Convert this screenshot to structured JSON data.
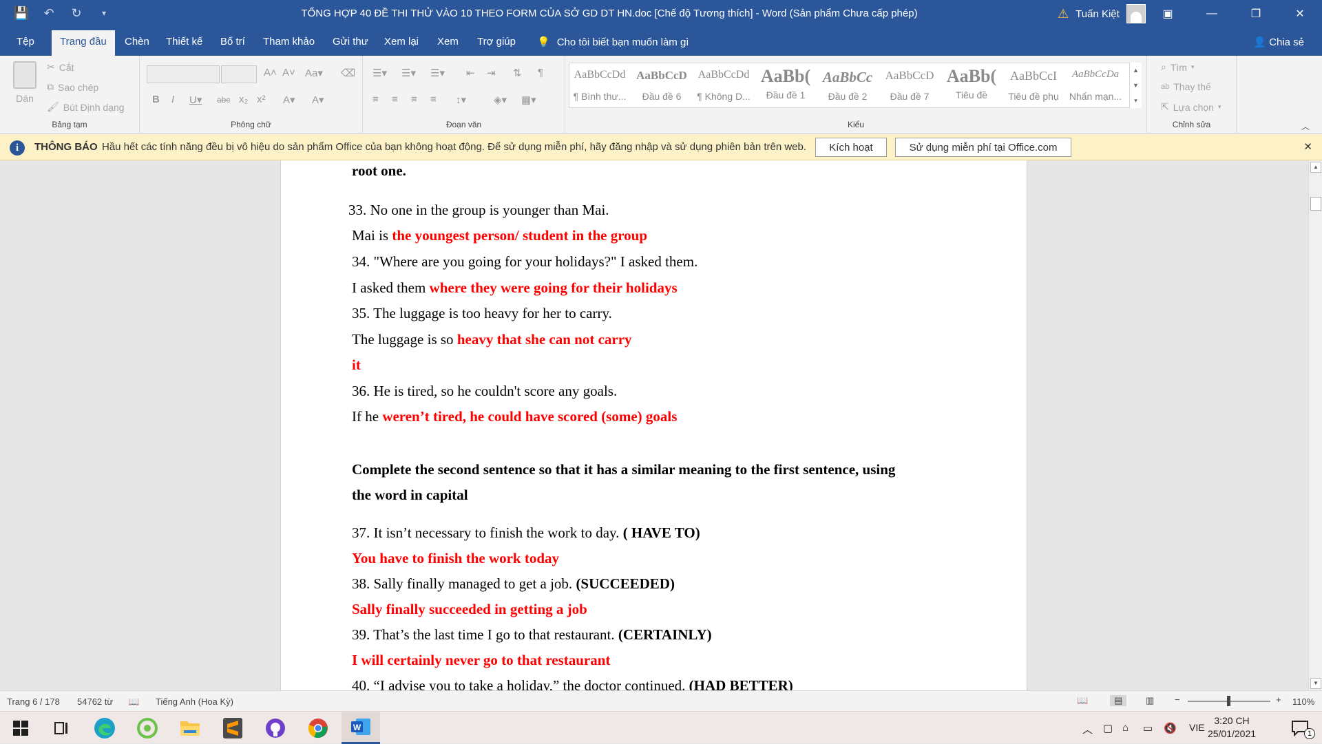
{
  "window": {
    "title": "TỔNG HỢP 40 ĐỀ THI THỬ VÀO 10 THEO FORM CỦA SỞ GD DT HN.doc [Chế độ Tương thích]  -  Word (Sản phẩm Chưa cấp phép)",
    "user": "Tuấn Kiệt"
  },
  "menu": {
    "tabs": [
      "Tệp",
      "Trang đầu",
      "Chèn",
      "Thiết kế",
      "Bố trí",
      "Tham khảo",
      "Gửi thư",
      "Xem lại",
      "Xem",
      "Trợ giúp"
    ],
    "tell_me": "Cho tôi biết bạn muốn làm gì",
    "share": "Chia sẻ"
  },
  "ribbon": {
    "clipboard": {
      "paste": "Dán",
      "cut": "Cắt",
      "copy": "Sao chép",
      "format_painter": "Bút Định dạng",
      "label": "Bảng tạm"
    },
    "font_label": "Phông chữ",
    "paragraph_label": "Đoạn văn",
    "styles_label": "Kiểu",
    "styles": [
      {
        "sample": "AaBbCcDd",
        "name": "¶ Bình thư..."
      },
      {
        "sample": "AaBbCcD",
        "name": "Đầu đề 6"
      },
      {
        "sample": "AaBbCcDd",
        "name": "¶ Không D..."
      },
      {
        "sample": "AaBb(",
        "name": "Đầu đề 1"
      },
      {
        "sample": "AaBbCc",
        "name": "Đầu đề 2"
      },
      {
        "sample": "AaBbCcD",
        "name": "Đầu đề 7"
      },
      {
        "sample": "AaBb(",
        "name": "Tiêu đề"
      },
      {
        "sample": "AaBbCcI",
        "name": "Tiêu đề phụ"
      },
      {
        "sample": "AaBbCcDa",
        "name": "Nhấn mạn..."
      }
    ],
    "editing": {
      "find": "Tìm",
      "replace": "Thay thế",
      "select": "Lựa chọn",
      "label": "Chỉnh sửa"
    }
  },
  "notice": {
    "title": "THÔNG BÁO",
    "message": "Hầu hết các tính năng đều bị vô hiệu do sản phẩm Office của bạn không hoạt động. Để sử dụng miễn phí, hãy đăng nhập và sử dụng phiên bản trên web.",
    "activate": "Kích hoạt",
    "use_free": "Sử dụng miễn phí tại Office.com"
  },
  "document": {
    "l01": "root one.",
    "l02": "33. No one in the group is younger than Mai.",
    "l03a": "Mai is ",
    "l03b": "the youngest person/ student in the group",
    "l04": "34. \"Where are you going for your holidays?\" I asked them.",
    "l05a": "I asked them ",
    "l05b": "where they were going for their holidays",
    "l06": "35. The luggage is too heavy for her to carry.",
    "l07a": "The luggage is so ",
    "l07b": "heavy that she can not carry",
    "l08": "it",
    "l09": "36. He is tired, so he couldn't score any goals.",
    "l10a": "If he ",
    "l10b": "weren’t tired, he could have scored (some) goals",
    "l11": "Complete the second sentence so that it has a similar meaning to the first sentence, using",
    "l12": "the word in capital",
    "l13a": "37. It isn’t necessary to finish the work to day. ",
    "l13b": "( HAVE TO)",
    "l14": "You have to finish the work today",
    "l15a": "38. Sally finally managed to get a job. ",
    "l15b": "(SUCCEEDED)",
    "l16": "Sally finally succeeded in getting a job",
    "l17a": "39. That’s the last time I go to that restaurant. ",
    "l17b": "(CERTAINLY)",
    "l18": "I will certainly never go to that restaurant",
    "l19a": "40. “I advise you to take a holiday,” the doctor continued. ",
    "l19b": "(HAD BETTER)"
  },
  "status": {
    "page": "Trang 6 / 178",
    "words": "54762 từ",
    "language": "Tiếng Anh (Hoa Kỳ)",
    "zoom": "110%"
  },
  "taskbar": {
    "lang": "VIE",
    "time": "3:20 CH",
    "date": "25/01/2021",
    "notif": "1"
  },
  "colors": {
    "accent": "#2b579a",
    "answer_red": "#ff0000",
    "notice_bg": "#fdf1c8"
  }
}
